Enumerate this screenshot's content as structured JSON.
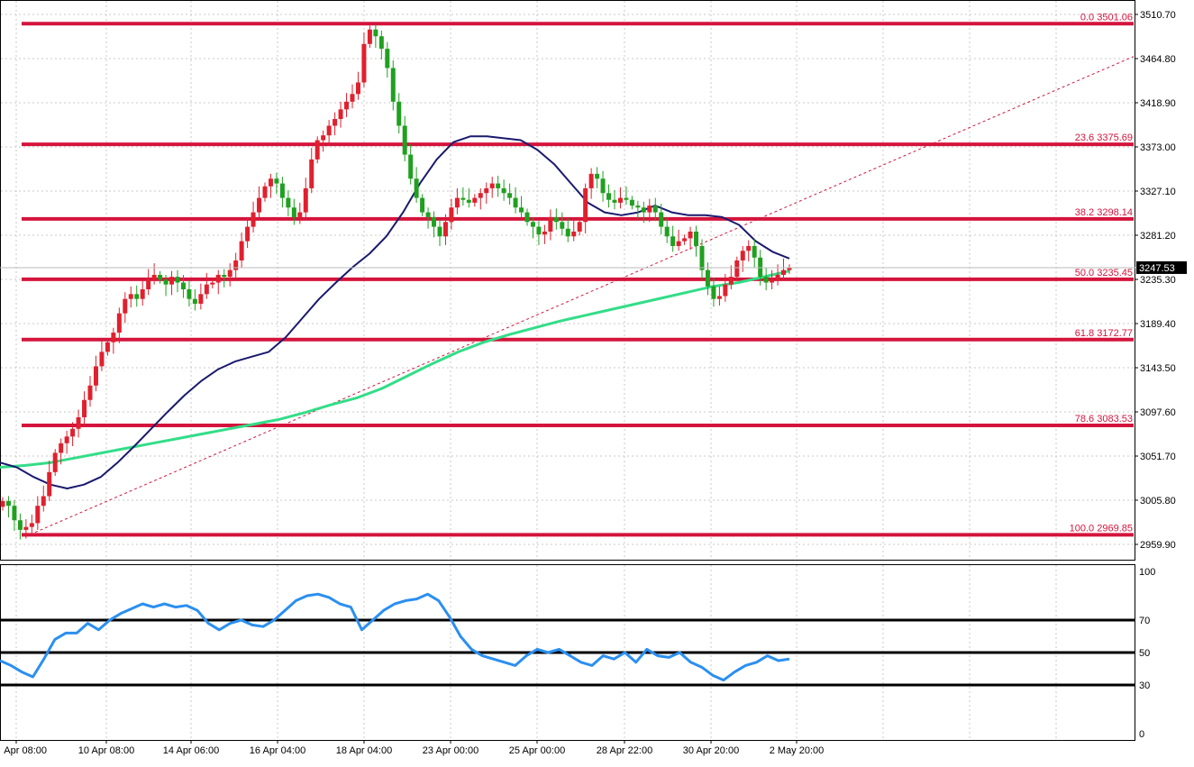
{
  "chart_data": [
    {
      "type": "candlestick",
      "y_ticks": [
        "3510.70",
        "3464.80",
        "3418.90",
        "3373.00",
        "3327.10",
        "3281.20",
        "3235.30",
        "3189.40",
        "3143.50",
        "3097.60",
        "3051.70",
        "3005.80",
        "2959.90"
      ],
      "ylim": [
        2955,
        3516
      ],
      "x_ticks": [
        "Apr 08:00",
        "10 Apr 08:00",
        "14 Apr 06:00",
        "16 Apr 04:00",
        "18 Apr 04:00",
        "23 Apr 00:00",
        "25 Apr 00:00",
        "28 Apr 22:00",
        "30 Apr 20:00",
        "2 May 20:00"
      ],
      "current_price": "3247.53",
      "fib_levels": [
        {
          "label": "0.0 3501.06",
          "value": 3501.06
        },
        {
          "label": "23.6 3375.69",
          "value": 3375.69
        },
        {
          "label": "38.2 3298.14",
          "value": 3298.14
        },
        {
          "label": "50.0 3235.45",
          "value": 3235.45
        },
        {
          "label": "61.8 3172.77",
          "value": 3172.77
        },
        {
          "label": "78.6 3083.53",
          "value": 3083.53
        },
        {
          "label": "100.0 2969.85",
          "value": 2969.85
        }
      ],
      "trendline": {
        "from": 2969.85,
        "to": 3467
      },
      "close_series": [
        3005,
        3000,
        2985,
        2975,
        2978,
        2982,
        3000,
        3010,
        3035,
        3055,
        3065,
        3072,
        3080,
        3092,
        3110,
        3125,
        3145,
        3160,
        3170,
        3180,
        3200,
        3215,
        3220,
        3215,
        3225,
        3235,
        3240,
        3235,
        3230,
        3238,
        3232,
        3225,
        3215,
        3210,
        3220,
        3230,
        3232,
        3240,
        3238,
        3245,
        3255,
        3275,
        3290,
        3305,
        3320,
        3332,
        3340,
        3335,
        3320,
        3310,
        3300,
        3305,
        3330,
        3360,
        3380,
        3385,
        3395,
        3402,
        3412,
        3420,
        3428,
        3440,
        3480,
        3495,
        3488,
        3475,
        3455,
        3420,
        3395,
        3365,
        3340,
        3320,
        3305,
        3300,
        3290,
        3280,
        3295,
        3310,
        3320,
        3318,
        3315,
        3320,
        3325,
        3330,
        3335,
        3330,
        3325,
        3320,
        3310,
        3305,
        3295,
        3290,
        3282,
        3285,
        3300,
        3295,
        3288,
        3280,
        3285,
        3295,
        3330,
        3345,
        3340,
        3325,
        3318,
        3315,
        3320,
        3318,
        3312,
        3310,
        3305,
        3312,
        3305,
        3290,
        3280,
        3270,
        3275,
        3278,
        3285,
        3270,
        3245,
        3228,
        3215,
        3218,
        3230,
        3238,
        3255,
        3265,
        3270,
        3258,
        3238,
        3232,
        3235,
        3240,
        3245,
        3247
      ],
      "ma_fast": {
        "color": "#1a1a6e",
        "values": [
          3045,
          3040,
          3030,
          3022,
          3018,
          3022,
          3030,
          3045,
          3062,
          3080,
          3098,
          3115,
          3130,
          3142,
          3150,
          3155,
          3160,
          3175,
          3195,
          3215,
          3232,
          3248,
          3262,
          3280,
          3305,
          3335,
          3360,
          3378,
          3384,
          3384,
          3382,
          3380,
          3370,
          3355,
          3335,
          3315,
          3305,
          3302,
          3305,
          3312,
          3305,
          3302,
          3302,
          3300,
          3292,
          3275,
          3264,
          3257
        ]
      },
      "ma_slow": {
        "color": "#33dd88",
        "values": [
          3040,
          3042,
          3045,
          3050,
          3055,
          3060,
          3065,
          3070,
          3075,
          3080,
          3085,
          3090,
          3097,
          3105,
          3112,
          3122,
          3135,
          3148,
          3160,
          3170,
          3178,
          3185,
          3192,
          3198,
          3204,
          3210,
          3216,
          3222,
          3228,
          3232,
          3238,
          3244
        ]
      }
    },
    {
      "type": "line",
      "y_ticks": [
        "100",
        "70",
        "50",
        "30",
        "0"
      ],
      "ylim": [
        0,
        100
      ],
      "levels": [
        70,
        50,
        30
      ],
      "series": [
        {
          "color": "#2b8ff0",
          "values": [
            45,
            42,
            38,
            35,
            46,
            58,
            62,
            62,
            68,
            64,
            70,
            74,
            77,
            80,
            78,
            80,
            78,
            79,
            76,
            68,
            64,
            68,
            70,
            67,
            66,
            70,
            76,
            82,
            85,
            86,
            84,
            80,
            78,
            64,
            70,
            76,
            80,
            82,
            83,
            86,
            82,
            72,
            60,
            52,
            48,
            46,
            44,
            42,
            48,
            52,
            50,
            52,
            48,
            44,
            42,
            48,
            46,
            50,
            44,
            52,
            48,
            47,
            50,
            44,
            41,
            36,
            33,
            38,
            42,
            44,
            48,
            45,
            46
          ]
        }
      ]
    }
  ]
}
